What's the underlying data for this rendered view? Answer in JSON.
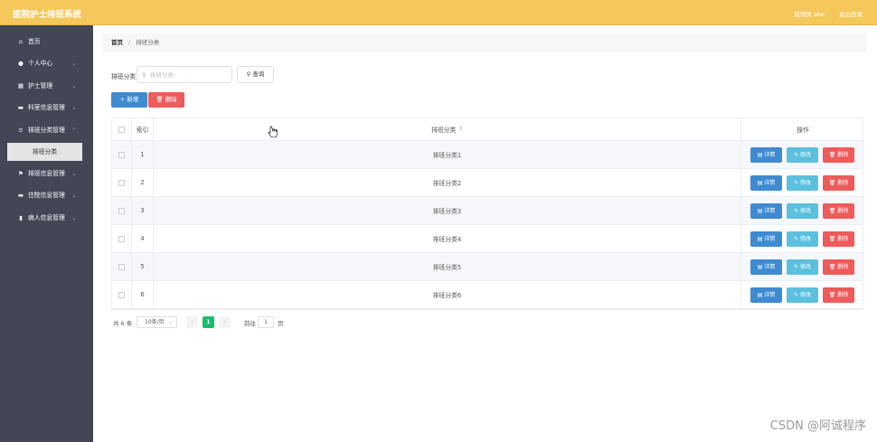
{
  "app": {
    "title": "医院护士排班系统"
  },
  "topbar": {
    "admin_label": "管理员 abo",
    "logout_label": "退出登录"
  },
  "sidebar": {
    "items": [
      {
        "label": "首页",
        "icon": "home-icon",
        "glyph": "⌂",
        "has_chevron": false
      },
      {
        "label": "个人中心",
        "icon": "user-icon",
        "glyph": "●",
        "has_chevron": true
      },
      {
        "label": "护士管理",
        "icon": "grid-icon",
        "glyph": "▦",
        "has_chevron": true
      },
      {
        "label": "科室信息管理",
        "icon": "comment-icon",
        "glyph": "▬",
        "has_chevron": true
      },
      {
        "label": "排班分类管理",
        "icon": "list-icon",
        "glyph": "≡",
        "has_chevron": true,
        "expanded": true
      },
      {
        "label": "排班信息管理",
        "icon": "flag-icon",
        "glyph": "⚑",
        "has_chevron": true
      },
      {
        "label": "住院信息管理",
        "icon": "chat-icon",
        "glyph": "▬",
        "has_chevron": true
      },
      {
        "label": "病人信息管理",
        "icon": "bar-chart-icon",
        "glyph": "▮",
        "has_chevron": true
      }
    ],
    "subitem": {
      "label": "排班分类"
    }
  },
  "breadcrumb": {
    "home": "首页",
    "separator": "/",
    "current": "排班分类"
  },
  "search": {
    "label": "排班分类",
    "placeholder": "排班分类",
    "value": "",
    "button_label": "查询"
  },
  "actions": {
    "add_label": "+ 新增",
    "delete_label": "删除"
  },
  "table": {
    "headers": {
      "index": "索引",
      "name": "排班分类",
      "ops": "操作"
    },
    "rows": [
      {
        "index": "1",
        "name": "排班分类1"
      },
      {
        "index": "2",
        "name": "排班分类2"
      },
      {
        "index": "3",
        "name": "排班分类3"
      },
      {
        "index": "4",
        "name": "排班分类4"
      },
      {
        "index": "5",
        "name": "排班分类5"
      },
      {
        "index": "6",
        "name": "排班分类6"
      }
    ],
    "op_labels": {
      "detail": "详情",
      "edit": "修改",
      "delete": "删除"
    }
  },
  "pagination": {
    "total_text": "共 6 条",
    "page_size": "10条/页",
    "current_page": "1",
    "goto_label": "前往",
    "goto_value": "1",
    "page_unit": "页"
  },
  "colors": {
    "topbar": "#f5c85c",
    "sidebar": "#424655",
    "primary": "#3e8bd1",
    "info": "#5bc0de",
    "danger": "#ee5b5b",
    "page_active": "#19be6b"
  },
  "watermark": "CSDN @阿诚程序"
}
